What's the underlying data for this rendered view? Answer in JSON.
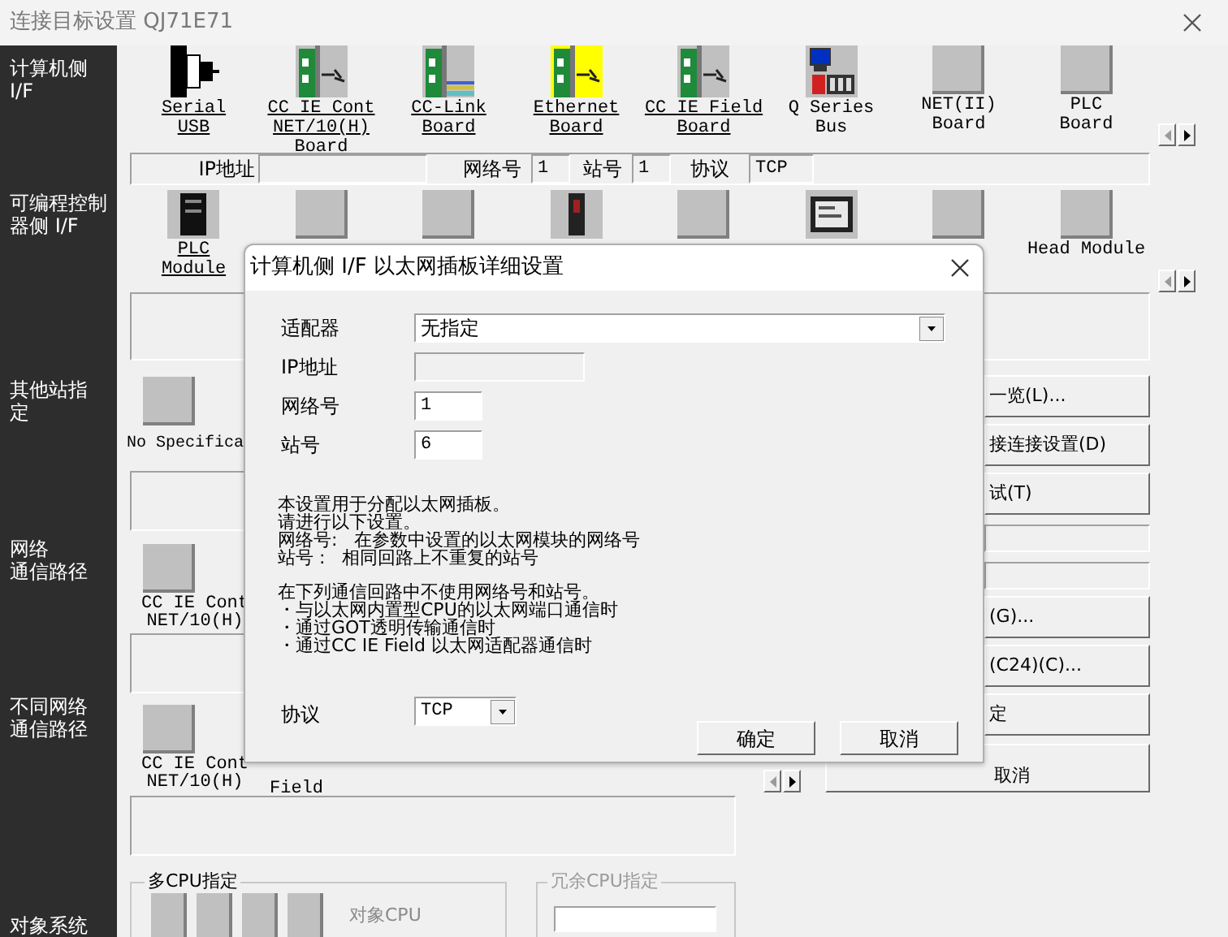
{
  "window": {
    "title": "连接目标设置 QJ71E71"
  },
  "sidebar": {
    "items": [
      {
        "lines": [
          "计算机侧",
          "I/F"
        ]
      },
      {
        "lines": [
          "可编程控制",
          "器侧 I/F"
        ]
      },
      {
        "lines": [
          "其他站指",
          "定"
        ]
      },
      {
        "lines": [
          "网络",
          "通信路径"
        ]
      },
      {
        "lines": [
          "不同网络",
          "通信路径"
        ]
      },
      {
        "lines": [
          "对象系统"
        ]
      }
    ]
  },
  "pc_side": {
    "items": [
      {
        "kind": "serial",
        "lines": [
          "Serial",
          "USB"
        ],
        "enabled": true,
        "selected": false
      },
      {
        "kind": "card-plug",
        "lines": [
          "CC IE Cont",
          "NET/10(H)",
          "Board"
        ],
        "enabled": true,
        "selected": false
      },
      {
        "kind": "card-cable",
        "lines": [
          "CC-Link",
          "Board"
        ],
        "enabled": true,
        "selected": false
      },
      {
        "kind": "card-plug",
        "lines": [
          "Ethernet",
          "Board"
        ],
        "enabled": true,
        "selected": true
      },
      {
        "kind": "card-plug",
        "lines": [
          "CC IE Field",
          "Board"
        ],
        "enabled": true,
        "selected": false
      },
      {
        "kind": "bus",
        "lines": [
          "Q Series",
          "Bus"
        ],
        "enabled": false,
        "selected": false
      },
      {
        "kind": "blank",
        "lines": [
          "NET(II)",
          "Board"
        ],
        "enabled": false,
        "selected": false
      },
      {
        "kind": "blank",
        "lines": [
          "PLC",
          "Board"
        ],
        "enabled": false,
        "selected": false
      }
    ]
  },
  "pc_settings": {
    "ip_label": "IP地址",
    "network_label": "网络号",
    "network_value": "1",
    "station_label": "站号",
    "station_value": "1",
    "protocol_label": "协议",
    "protocol_value": "TCP"
  },
  "plc_side": {
    "items": [
      {
        "kind": "plc",
        "lines": [
          "PLC",
          "Module"
        ],
        "enabled": true
      },
      {
        "kind": "blank"
      },
      {
        "kind": "blank"
      },
      {
        "kind": "module"
      },
      {
        "kind": "blank"
      },
      {
        "kind": "got"
      },
      {
        "kind": "blank"
      },
      {
        "kind": "blank",
        "lines": [
          "Head Module"
        ],
        "enabled": false
      }
    ]
  },
  "other_station": {
    "label": "No Specifica"
  },
  "network_path": {
    "lines": [
      "CC IE Cont",
      "NET/10(H)"
    ]
  },
  "different_network": {
    "lines": [
      "CC IE Cont",
      "NET/10(H)"
    ],
    "second_label": "Field"
  },
  "right_buttons": [
    {
      "kind": "button",
      "label": "一览(L)..."
    },
    {
      "kind": "button",
      "label": "接连接设置(D)"
    },
    {
      "kind": "button",
      "label": "试(T)"
    },
    {
      "kind": "field"
    },
    {
      "kind": "field"
    },
    {
      "kind": "button",
      "label": "(G)..."
    },
    {
      "kind": "button",
      "label": "(C24)(C)..."
    },
    {
      "kind": "button",
      "label": "定"
    },
    {
      "kind": "wide-button",
      "label": "取消"
    }
  ],
  "multi_cpu": {
    "title": "多CPU指定",
    "target_label": "对象CPU"
  },
  "redundant_cpu": {
    "title": "冗余CPU指定",
    "disabled": true
  },
  "dialog": {
    "title": "计算机侧 I/F 以太网插板详细设置",
    "adapter_label": "适配器",
    "adapter_value": "无指定",
    "ip_label": "IP地址",
    "ip_disabled": true,
    "network_label": "网络号",
    "network_value": "1",
    "station_label": "站号",
    "station_value": "6",
    "paragraphs": [
      [
        "本设置用于分配以太网插板。",
        "请进行以下设置。",
        "网络号:   在参数中设置的以太网模块的网络号",
        "站号 :   相同回路上不重复的站号"
      ],
      [
        "在下列通信回路中不使用网络号和站号。",
        "・与以太网内置型CPU的以太网端口通信时",
        "・通过GOT透明传输通信时",
        "・通过CC IE Field 以太网适配器通信时"
      ]
    ],
    "protocol_label": "协议",
    "protocol_value": "TCP",
    "buttons": [
      "确定",
      "取消"
    ]
  }
}
